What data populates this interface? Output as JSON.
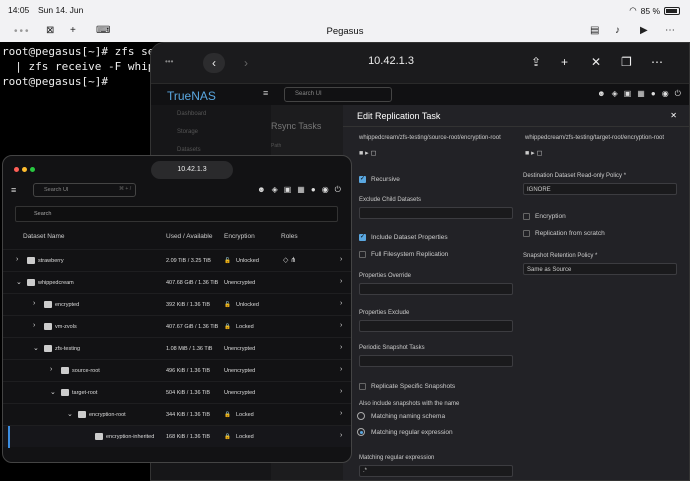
{
  "status_bar": {
    "time": "14:05",
    "date": "Sun 14. Jun",
    "battery": "85 %"
  },
  "terminal_app": {
    "title": "Pegasus",
    "lines": [
      "root@pegasus[~]# zfs se",
      "  | zfs receive -F whipp",
      "root@pegasus[~]#"
    ]
  },
  "browser_main": {
    "url": "10.42.1.3",
    "brand": "TrueNAS",
    "search_placeholder": "Search UI",
    "sidebar": [
      "Dashboard",
      "Storage",
      "Datasets"
    ],
    "background_heading": "Rsync Tasks",
    "background_col": "Path"
  },
  "replication": {
    "title": "Edit Replication Task",
    "source_path": "whippedcream/zfs-testing/source-root/encryption-root",
    "target_path": "whippedcream/zfs-testing/target-root/encryption-root",
    "recursive": "Recursive",
    "exclude_child": "Exclude Child Datasets",
    "include_props": "Include Dataset Properties",
    "full_fs": "Full Filesystem Replication",
    "props_override": "Properties Override",
    "props_exclude": "Properties Exclude",
    "periodic": "Periodic Snapshot Tasks",
    "replicate_specific": "Replicate Specific Snapshots",
    "also_include": "Also include snapshots with the name",
    "matching_naming": "Matching naming schema",
    "matching_regex": "Matching regular expression",
    "regex_label": "Matching regular expression",
    "regex_value": ".*",
    "dest_readonly_label": "Destination Dataset Read-only Policy *",
    "dest_readonly_value": "IGNORE",
    "encryption": "Encryption",
    "from_scratch": "Replication from scratch",
    "retention_label": "Snapshot Retention Policy *",
    "retention_value": "Same as Source"
  },
  "browser_small": {
    "url": "10.42.1.3",
    "search_placeholder": "Search UI",
    "shortcut": "⌘ + /",
    "table_search": "Search",
    "columns": [
      "Dataset Name",
      "Used / Available",
      "Encryption",
      "Roles"
    ],
    "rows": [
      {
        "name": "strawberry",
        "used": "2.09 TiB / 3.25 TiB",
        "enc": "Unlocked"
      },
      {
        "name": "whippedcream",
        "used": "407.68 GiB / 1.36 TiB",
        "enc": "Unencrypted"
      },
      {
        "name": "encrypted",
        "used": "392 KiB / 1.36 TiB",
        "enc": "Unlocked"
      },
      {
        "name": "vm-zvols",
        "used": "407.67 GiB / 1.36 TiB",
        "enc": "Locked"
      },
      {
        "name": "zfs-testing",
        "used": "1.08 MiB / 1.36 TiB",
        "enc": "Unencrypted"
      },
      {
        "name": "source-root",
        "used": "496 KiB / 1.36 TiB",
        "enc": "Unencrypted"
      },
      {
        "name": "target-root",
        "used": "504 KiB / 1.36 TiB",
        "enc": "Unencrypted"
      },
      {
        "name": "encryption-root",
        "used": "344 KiB / 1.36 TiB",
        "enc": "Locked"
      },
      {
        "name": "encryption-inherited",
        "used": "168 KiB / 1.36 TiB",
        "enc": "Locked"
      }
    ]
  },
  "colors": {
    "accent": "#5aa7e0",
    "selection": "#3b8de0",
    "bg": "#121214"
  }
}
